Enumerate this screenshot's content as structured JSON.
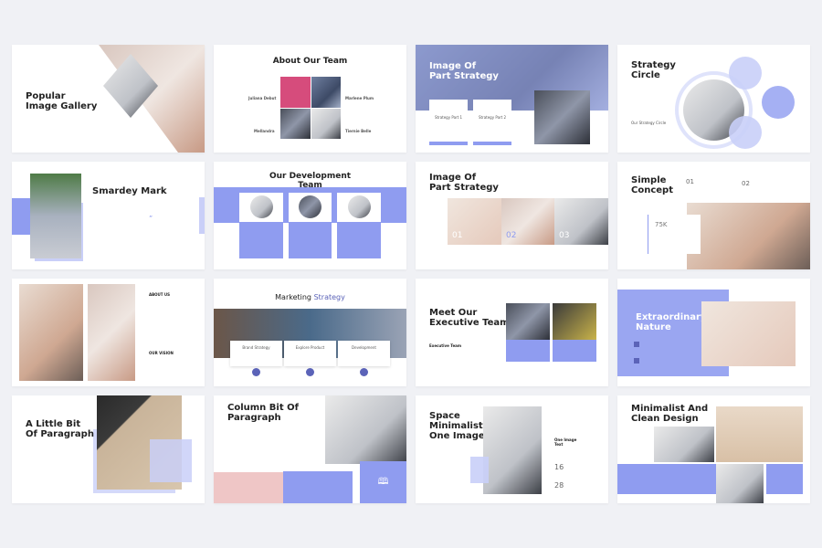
{
  "colors": {
    "accent": "#8f9cf0",
    "background": "#f0f1f5"
  },
  "slides": {
    "s1": {
      "title_line1": "Popular",
      "title_line2": "Image Gallery"
    },
    "s2": {
      "title": "About Our Team",
      "members": [
        {
          "name": "Juliana Debut"
        },
        {
          "name": "Marlene Plum"
        },
        {
          "name": "Mellandra"
        },
        {
          "name": "Tiernie Belle"
        }
      ]
    },
    "s3": {
      "title_line1": "Image Of",
      "title_line2": "Part Strategy",
      "cards": [
        {
          "label": "Strategy Part 1"
        },
        {
          "label": "Strategy Part 2"
        }
      ]
    },
    "s4": {
      "title_line1": "Strategy",
      "title_line2": "Circle",
      "subtitle": "Our Strategy Circle"
    },
    "s5": {
      "title": "Smardey Mark",
      "quote_mark": "”"
    },
    "s6": {
      "title_line1": "Our Development",
      "title_line2": "Team"
    },
    "s7": {
      "title_line1": "Image Of",
      "title_line2": "Part Strategy",
      "numbers": [
        "01",
        "02",
        "03"
      ]
    },
    "s8": {
      "title_line1": "Simple",
      "title_line2": "Concept",
      "points": [
        "01",
        "02"
      ],
      "stat": "75K"
    },
    "s9": {
      "heading1": "ABOUT US",
      "heading2": "OUR VISION"
    },
    "s10": {
      "title_plain": "Marketing ",
      "title_accent": "Strategy",
      "cards": [
        "Brand Strategy",
        "Explore Product",
        "Development"
      ]
    },
    "s11": {
      "title_line1": "Meet Our",
      "title_line2": "Executive Team",
      "subtitle": "Executive Team"
    },
    "s12": {
      "title_line1": "Extraordinary",
      "title_line2": "Nature"
    },
    "s13": {
      "title_line1": "A Little Bit",
      "title_line2": "Of Paragraph"
    },
    "s14": {
      "title_line1": "Column Bit Of",
      "title_line2": "Paragraph"
    },
    "s15": {
      "title_line1": "Space",
      "title_line2": "Minimalist",
      "title_line3": "One Image",
      "side_title": "One Image Text",
      "stats": [
        "16",
        "28"
      ]
    },
    "s16": {
      "title_line1": "Minimalist And",
      "title_line2": "Clean Design"
    }
  }
}
